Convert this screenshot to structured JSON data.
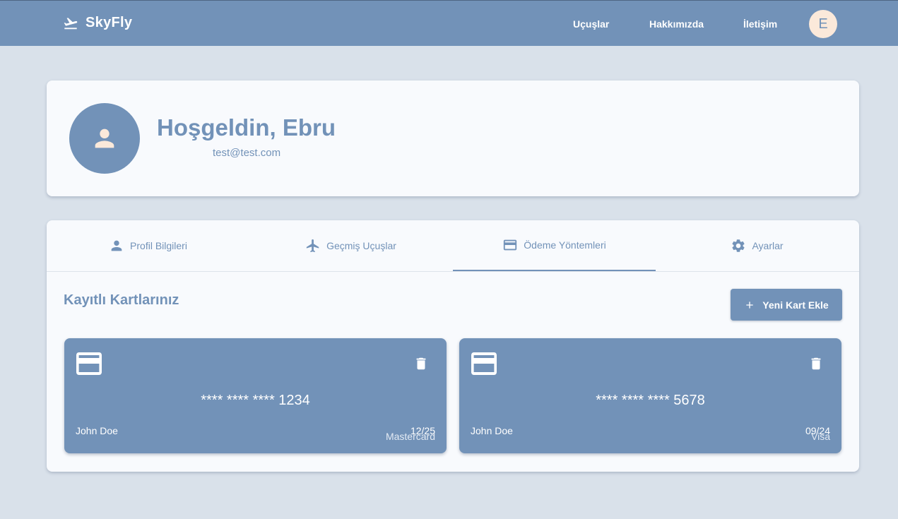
{
  "navbar": {
    "brand": "SkyFly",
    "links": [
      "Uçuşlar",
      "Hakkımızda",
      "İletişim"
    ],
    "avatar_initial": "E"
  },
  "profile": {
    "welcome": "Hoşgeldin, Ebru",
    "email": "test@test.com"
  },
  "tabs": [
    {
      "label": "Profil Bilgileri",
      "icon": "person-icon",
      "active": false
    },
    {
      "label": "Geçmiş Uçuşlar",
      "icon": "airplane-icon",
      "active": false
    },
    {
      "label": "Ödeme Yöntemleri",
      "icon": "credit-card-icon",
      "active": true
    },
    {
      "label": "Ayarlar",
      "icon": "gear-icon",
      "active": false
    }
  ],
  "payments": {
    "title": "Kayıtlı Kartlarınız",
    "add_button": "Yeni Kart Ekle",
    "cards": [
      {
        "number": "**** **** **** 1234",
        "holder": "John Doe",
        "expiry": "12/25",
        "type": "Mastercard"
      },
      {
        "number": "**** **** **** 5678",
        "holder": "John Doe",
        "expiry": "09/24",
        "type": "Visa"
      }
    ]
  },
  "colors": {
    "primary": "#7292b8",
    "background": "#d9e1ea",
    "card": "#f8fafd",
    "avatar_bg": "#fbe9da"
  }
}
